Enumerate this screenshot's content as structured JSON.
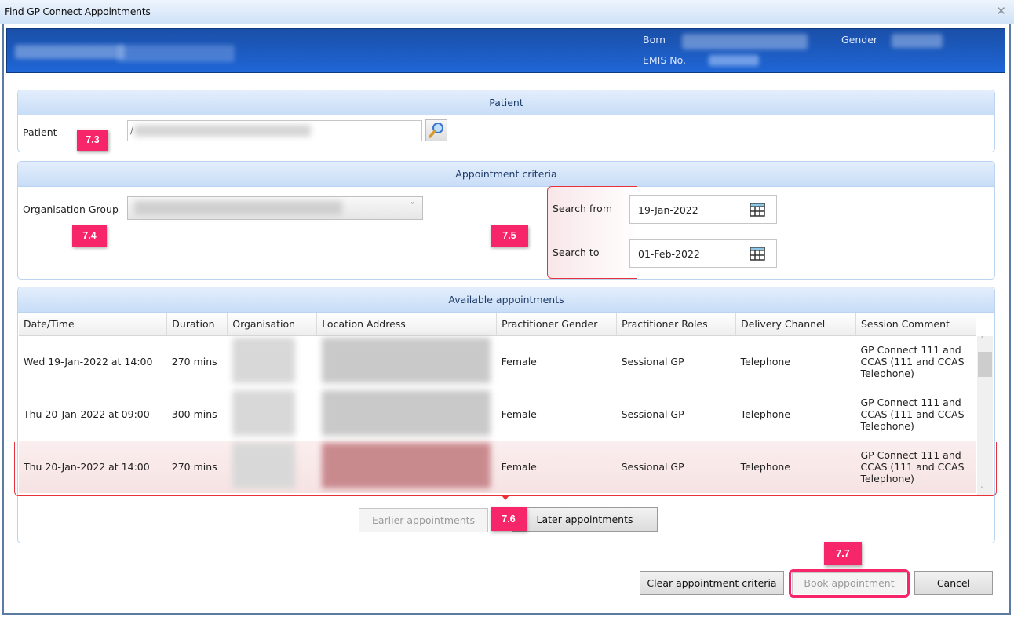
{
  "window": {
    "title": "Find GP Connect Appointments",
    "close_icon": "close-icon"
  },
  "banner": {
    "born_label": "Born",
    "gender_label": "Gender",
    "emis_label": "EMIS No."
  },
  "patient_panel": {
    "header": "Patient",
    "label": "Patient",
    "input_value": "/",
    "search_icon": "magnifier-icon",
    "annotation": "7.3"
  },
  "criteria_panel": {
    "header": "Appointment criteria",
    "org_group_label": "Organisation Group",
    "org_group_annotation": "7.4",
    "search_from_label": "Search from",
    "search_from_value": "19-Jan-2022",
    "search_to_label": "Search to",
    "search_to_value": "01-Feb-2022",
    "dates_annotation": "7.5",
    "calendar_icon": "calendar-icon"
  },
  "available_panel": {
    "header": "Available appointments",
    "columns": [
      "Date/Time",
      "Duration",
      "Organisation",
      "Location Address",
      "Practitioner Gender",
      "Practitioner Roles",
      "Delivery Channel",
      "Session Comment"
    ],
    "rows": [
      {
        "datetime": "Wed 19-Jan-2022 at 14:00",
        "duration": "270 mins",
        "gender": "Female",
        "roles": "Sessional GP",
        "channel": "Telephone",
        "comment": "GP Connect 111 and CCAS (111 and CCAS Telephone)",
        "selected": false
      },
      {
        "datetime": "Thu 20-Jan-2022 at 09:00",
        "duration": "300 mins",
        "gender": "Female",
        "roles": "Sessional GP",
        "channel": "Telephone",
        "comment": "GP Connect 111 and CCAS (111 and CCAS Telephone)",
        "selected": false
      },
      {
        "datetime": "Thu 20-Jan-2022 at 14:00",
        "duration": "270 mins",
        "gender": "Female",
        "roles": "Sessional GP",
        "channel": "Telephone",
        "comment": "GP Connect 111 and CCAS (111 and CCAS Telephone)",
        "selected": true
      }
    ],
    "earlier_label": "Earlier appointments",
    "later_label": "Later appointments",
    "paging_annotation": "7.6"
  },
  "footer": {
    "clear_label": "Clear appointment criteria",
    "book_label": "Book appointment",
    "cancel_label": "Cancel",
    "book_annotation": "7.7"
  },
  "colors": {
    "annotation": "#f7266a",
    "banner": "#1f66d6",
    "highlight_bracket": "#e8323a"
  }
}
